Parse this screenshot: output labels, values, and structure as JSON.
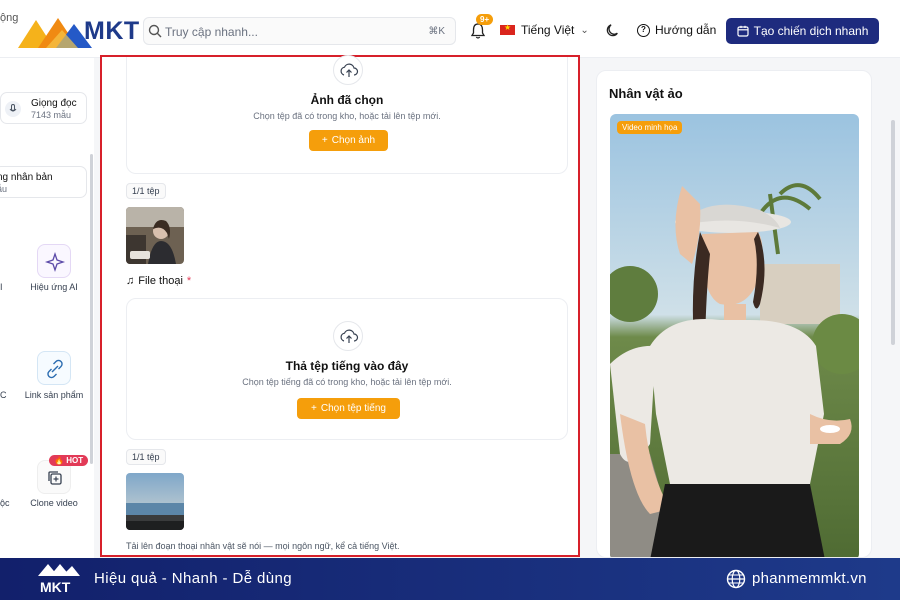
{
  "header": {
    "logo_clip": "ộng",
    "logo_text": "MKT",
    "search_placeholder": "Truy cập nhanh...",
    "search_shortcut": "⌘K",
    "notif_badge": "9+",
    "language": "Tiếng Việt",
    "help_label": "Hướng dẫn",
    "cta_label": "Tạo chiến dịch nhanh"
  },
  "sidebar": {
    "voice_title": "Giọng đọc",
    "voice_count": "7143 mẫu",
    "clone_title": "ng nhân bản",
    "clone_sub": "ẫu",
    "tools": [
      {
        "label": "Hiệu ứng AI",
        "clip": "I"
      },
      {
        "label": "Link sản phẩm",
        "clip": "C"
      },
      {
        "label": "Clone video",
        "clip": "ộc"
      }
    ],
    "hot_badge": "HOT"
  },
  "main": {
    "image_zone": {
      "title": "Ảnh đã chọn",
      "subtitle": "Chọn tệp đã có trong kho, hoặc tải lên tệp mới.",
      "button": "Chọn ảnh"
    },
    "image_count": "1/1 tệp",
    "audio_label": "File thoại",
    "audio_required": "*",
    "audio_zone": {
      "title": "Thả tệp tiếng vào đây",
      "subtitle": "Chọn tệp tiếng đã có trong kho, hoặc tải lên tệp mới.",
      "button": "Chọn tệp tiếng"
    },
    "audio_count": "1/1 tệp",
    "hint": "Tải lên đoạn thoại nhân vật sẽ nói — mọi ngôn ngữ, kể cả tiếng Việt."
  },
  "right_panel": {
    "title": "Nhân vật ảo",
    "video_tag": "Video minh họa"
  },
  "footer": {
    "slogan": "Hiệu quả - Nhanh - Dễ dùng",
    "website": "phanmemmkt.vn"
  },
  "colors": {
    "brand_navy": "#1e2b7e",
    "accent_orange": "#f59e0b",
    "highlight_red": "#d7202a",
    "hot_red": "#e23a57"
  }
}
